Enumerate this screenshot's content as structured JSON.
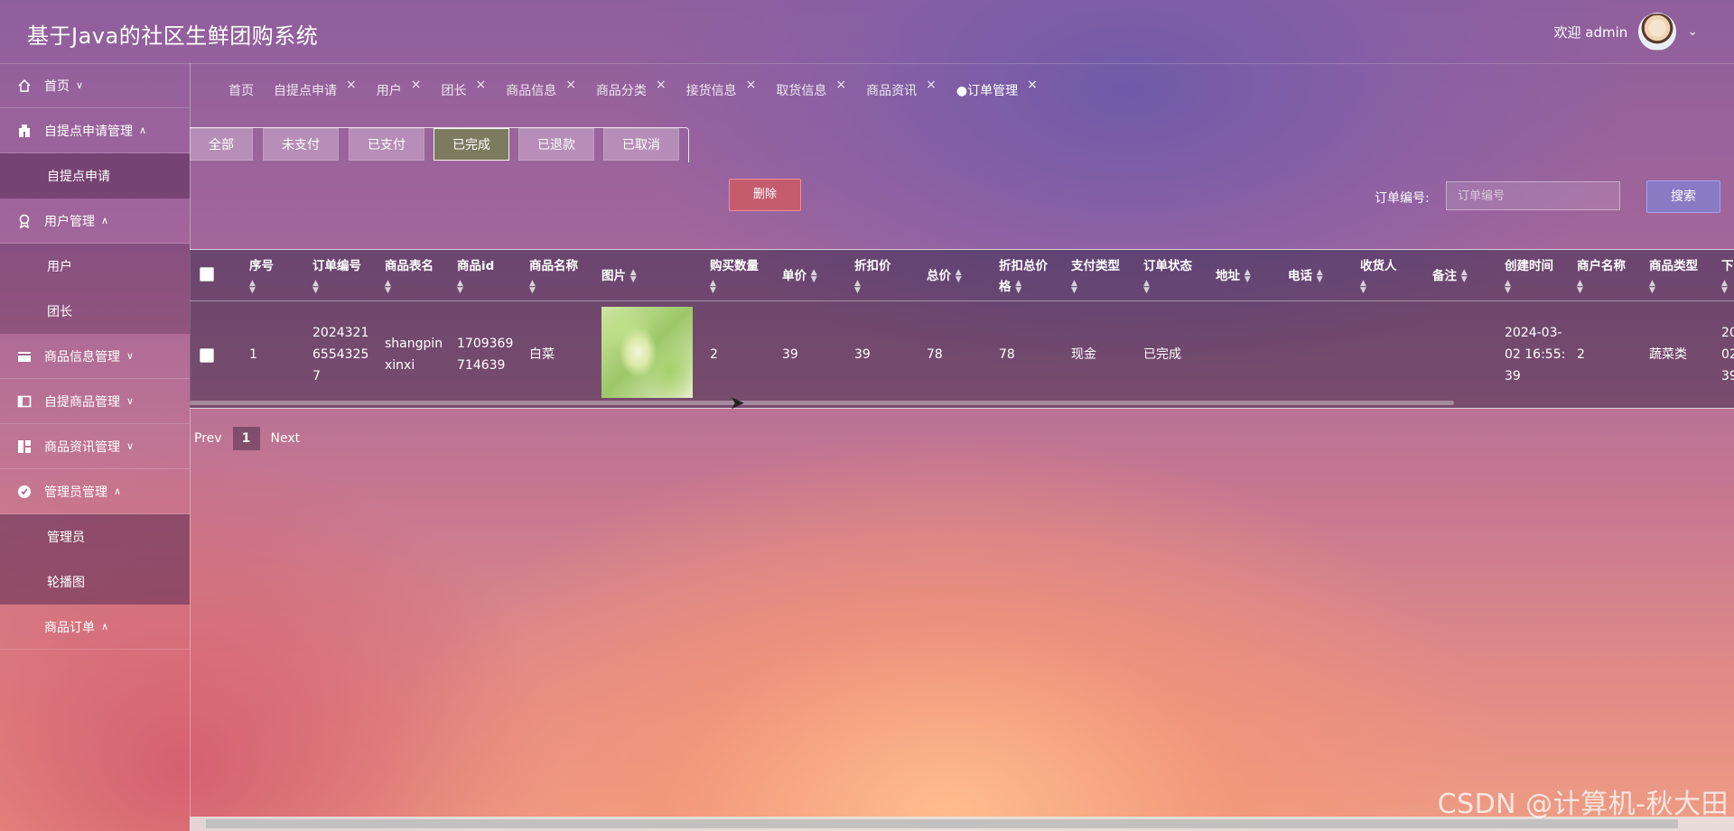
{
  "header": {
    "title": "基于Java的社区生鲜团购系统",
    "welcome": "欢迎 admin"
  },
  "sidebar": {
    "items": [
      {
        "label": "首页",
        "icon": "home-icon",
        "arrow": "∨"
      },
      {
        "label": "自提点申请管理",
        "icon": "building-icon",
        "arrow": "∧"
      },
      {
        "sub": "自提点申请"
      },
      {
        "label": "用户管理",
        "icon": "user-badge-icon",
        "arrow": "∧"
      },
      {
        "sub": "用户"
      },
      {
        "sub": "团长"
      },
      {
        "label": "商品信息管理",
        "icon": "card-icon",
        "arrow": "∨"
      },
      {
        "label": "自提商品管理",
        "icon": "panel-icon",
        "arrow": "∨"
      },
      {
        "label": "商品资讯管理",
        "icon": "grid-icon",
        "arrow": "∨"
      },
      {
        "label": "管理员管理",
        "icon": "check-circle-icon",
        "arrow": "∧"
      },
      {
        "sub": "管理员"
      },
      {
        "sub": "轮播图"
      },
      {
        "label": "商品订单",
        "icon": "",
        "arrow": "∧"
      }
    ]
  },
  "tabs": [
    "首页",
    "自提点申请",
    "用户",
    "团长",
    "商品信息",
    "商品分类",
    "接货信息",
    "取货信息",
    "商品资讯",
    "●订单管理"
  ],
  "status_filters": [
    "全部",
    "未支付",
    "已支付",
    "已完成",
    "已退款",
    "已取消"
  ],
  "active_status": "已完成",
  "toolbar": {
    "delete_label": "删除",
    "search_label": "订单编号:",
    "search_placeholder": "订单编号",
    "search_button": "搜索"
  },
  "table": {
    "columns": [
      "序号",
      "订单编号",
      "商品表名",
      "商品id",
      "商品名称",
      "图片",
      "购买数量",
      "单价",
      "折扣价",
      "总价",
      "折扣总价格",
      "支付类型",
      "订单状态",
      "地址",
      "电话",
      "收货人",
      "备注",
      "创建时间",
      "商户名称",
      "商品类型",
      "下"
    ],
    "rows": [
      {
        "index": "1",
        "order_no": "20243216554325​7",
        "order_no_lines": [
          "2024321",
          "6554325",
          "7"
        ],
        "table_name_lines": [
          "shangpin",
          "xinxi"
        ],
        "goods_id_lines": [
          "1709369",
          "714639"
        ],
        "goods_name": "白菜",
        "quantity": "2",
        "price": "39",
        "discount_price": "39",
        "total": "78",
        "discount_total": "78",
        "pay_type": "现金",
        "status": "已完成",
        "created_lines": [
          "2024-03-",
          "02 16:55:",
          "39"
        ],
        "merchant": "2",
        "goods_type": "蔬菜类",
        "extra_lines": [
          "20",
          "02",
          "39"
        ]
      }
    ]
  },
  "pager": {
    "prev": "Prev",
    "page": "1",
    "next": "Next"
  },
  "watermark": "CSDN @计算机-秋大田"
}
